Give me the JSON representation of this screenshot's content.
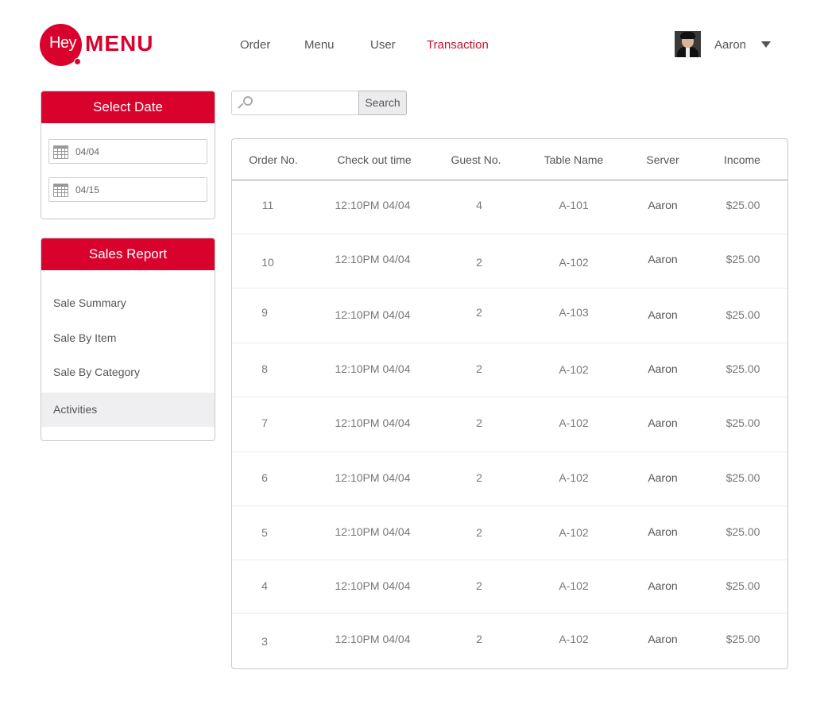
{
  "logo": {
    "hey": "Hey",
    "menu": "MENU"
  },
  "nav": [
    {
      "label": "Order",
      "active": false
    },
    {
      "label": "Menu",
      "active": false
    },
    {
      "label": "User",
      "active": false
    },
    {
      "label": "Transaction",
      "active": true
    }
  ],
  "user": {
    "name": "Aaron",
    "avatar_icon": "user-avatar",
    "menu_icon": "caret-down-icon"
  },
  "select_date": {
    "title": "Select Date",
    "start": "04/04",
    "end": "04/15",
    "icon": "calendar-icon"
  },
  "sales_report": {
    "title": "Sales Report",
    "items": [
      {
        "label": "Sale Summary",
        "active": false
      },
      {
        "label": "Sale By Item",
        "active": false
      },
      {
        "label": "Sale By Category",
        "active": false
      },
      {
        "label": "Activities",
        "active": true
      }
    ]
  },
  "search": {
    "value": "",
    "button": "Search",
    "icon": "search-icon"
  },
  "table": {
    "columns": [
      "Order No.",
      "Check out time",
      "Guest No.",
      "Table Name",
      "Server",
      "Income"
    ],
    "rows": [
      [
        "11",
        "12:10PM 04/04",
        "4",
        "A-101",
        "Aaron",
        "$25.00"
      ],
      [
        "10",
        "12:10PM 04/04",
        "2",
        "A-102",
        "Aaron",
        "$25.00"
      ],
      [
        "9",
        "12:10PM 04/04",
        "2",
        "A-103",
        "Aaron",
        "$25.00"
      ],
      [
        "8",
        "12:10PM 04/04",
        "2",
        "A-102",
        "Aaron",
        "$25.00"
      ],
      [
        "7",
        "12:10PM 04/04",
        "2",
        "A-102",
        "Aaron",
        "$25.00"
      ],
      [
        "6",
        "12:10PM 04/04",
        "2",
        "A-102",
        "Aaron",
        "$25.00"
      ],
      [
        "5",
        "12:10PM 04/04",
        "2",
        "A-102",
        "Aaron",
        "$25.00"
      ],
      [
        "4",
        "12:10PM 04/04",
        "2",
        "A-102",
        "Aaron",
        "$25.00"
      ],
      [
        "3",
        "12:10PM 04/04",
        "2",
        "A-102",
        "Aaron",
        "$25.00"
      ]
    ]
  },
  "colors": {
    "brand": "#d9022d",
    "active_nav": "#c8102e",
    "active_item_bg": "#efeff2"
  }
}
